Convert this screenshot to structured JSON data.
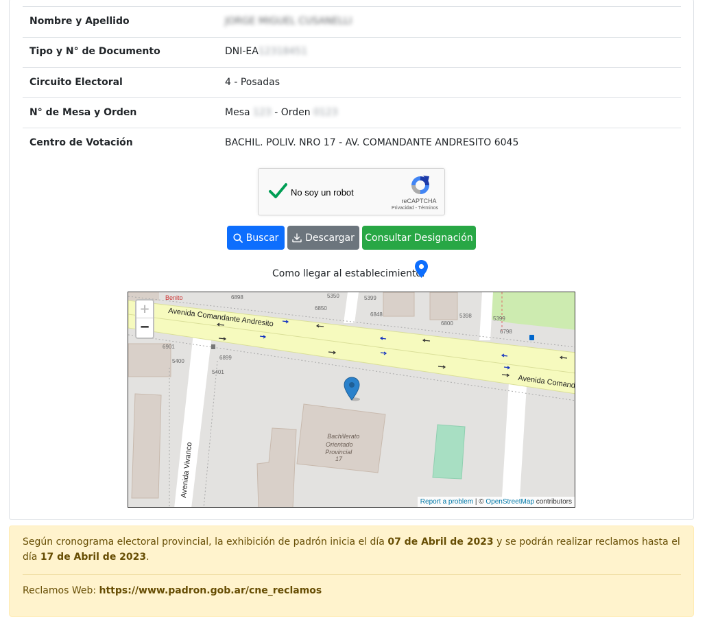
{
  "details": [
    {
      "label": "Nombre y Apellido",
      "value": "JORGE MIGUEL CUSANELLI"
    },
    {
      "label": "Tipo y N° de Documento",
      "value_prefix": "DNI-EA",
      "value": "12318451"
    },
    {
      "label": "Circuito Electoral",
      "value": "4 - Posadas"
    },
    {
      "label": "N° de Mesa y Orden",
      "mesa_label": "Mesa",
      "mesa": "123",
      "orden_label": "- Orden",
      "orden": "0123"
    },
    {
      "label": "Centro de Votación",
      "value": "BACHIL. POLIV. NRO 17 - AV. COMANDANTE ANDRESITO 6045"
    }
  ],
  "captcha": {
    "text": "No soy un robot",
    "brand": "reCAPTCHA",
    "terms": "Privacidad - Términos",
    "checked": true
  },
  "buttons": {
    "search": "Buscar",
    "download": "Descargar",
    "consult": "Consultar Designación"
  },
  "directions_label": "Como llegar al establecimiento:",
  "map": {
    "street_top": "Avenida Comandante Andresito",
    "street_right": "Avenida Comand",
    "street_vertical": "Avenida Vivanco",
    "place_name": [
      "Bachillerato",
      "Orientado",
      "Provincial",
      "17"
    ],
    "place_top_left": "Benito",
    "house_numbers": [
      "6898",
      "5350",
      "6850",
      "5399",
      "6848",
      "5398",
      "6800",
      "5399",
      "6798",
      "6901",
      "5400",
      "6899",
      "5401"
    ],
    "zoom_in": "+",
    "zoom_out": "−",
    "attribution": {
      "report": "Report a problem",
      "separator": " | © ",
      "osm": "OpenStreetMap",
      "suffix": " contributors"
    }
  },
  "notice": {
    "text1": "Según cronograma electoral provincial, la exhibición de padrón inicia el día ",
    "date1": "07 de Abril de 2023",
    "text2": " y se podrán realizar reclamos hasta el día ",
    "date2": "17 de Abril de 2023",
    "text3": ".",
    "web_label": "Reclamos Web: ",
    "web_url": "https://www.padron.gob.ar/cne_reclamos"
  },
  "colors": {
    "primary": "#0d6efd",
    "secondary": "#6c757d",
    "success": "#28a745",
    "alert_bg": "#fff3cd",
    "alert_text": "#664d03"
  }
}
